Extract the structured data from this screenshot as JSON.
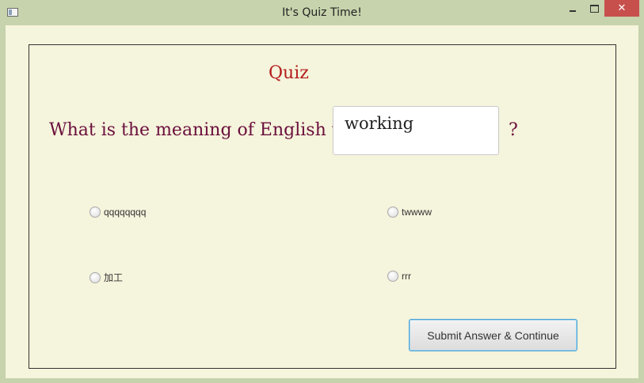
{
  "window": {
    "title": "It's Quiz Time!",
    "close_glyph": "✕"
  },
  "quiz": {
    "heading": "Quiz",
    "question_prefix": "What is the meaning of English word",
    "word": "working",
    "question_suffix": "?",
    "options": [
      "qqqqqqqq",
      "twwww",
      "加工",
      "rrr"
    ],
    "selected": null,
    "submit_label": "Submit Answer & Continue"
  },
  "colors": {
    "frame": "#c6d3ac",
    "background": "#f5f4dc",
    "heading": "#b41d1d",
    "question": "#6b0f3d",
    "close": "#c7504d",
    "button_focus": "#4aa2d6"
  }
}
